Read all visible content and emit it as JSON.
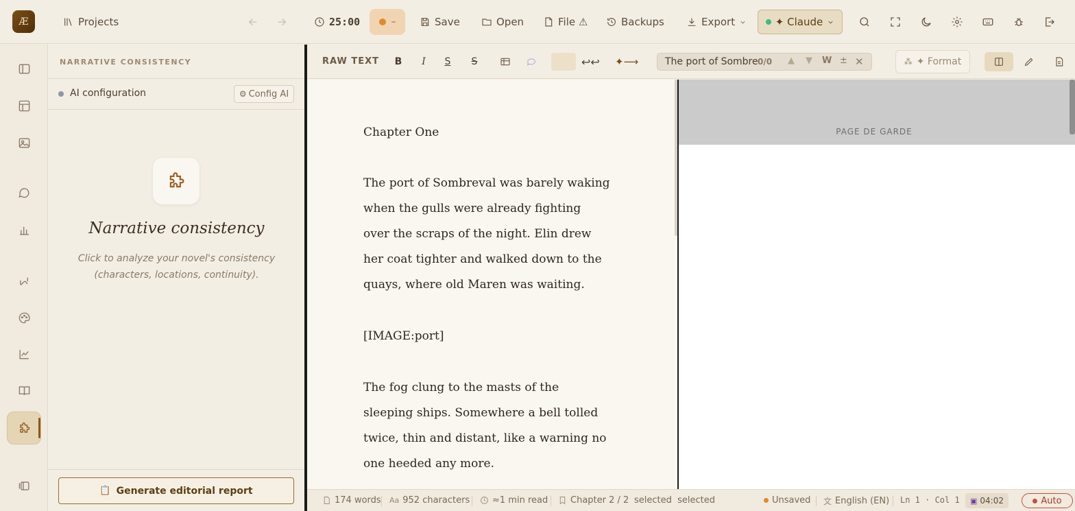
{
  "app": {
    "logo": "Æ"
  },
  "topbar": {
    "projects": "Projects",
    "timer": "25:00",
    "pomodoro_state": "–",
    "save": "Save",
    "open": "Open",
    "file": "File ⚠",
    "backups": "Backups",
    "export": "Export",
    "ai_model": "✦ Claude",
    "ai_status_color": "#3dbd7d"
  },
  "sidebar": {
    "title": "NARRATIVE CONSISTENCY",
    "ai_config_label": "AI configuration",
    "config_button": "Config AI",
    "heading": "Narrative consistency",
    "description": "Click to analyze your novel's consistency (characters, locations, continuity).",
    "report_button": "Generate editorial report"
  },
  "editor_toolbar": {
    "mode": "RAW TEXT",
    "bold": "B",
    "italic": "I",
    "underline": "S",
    "strike": "S",
    "search_value": "The port of Sombre",
    "search_count": "0/0",
    "search_word": "W",
    "search_case": "±",
    "format_button": "✦ Format"
  },
  "editor": {
    "paragraphs": [
      "Chapter One",
      "The port of Sombreval was barely waking when the gulls were already fighting over the scraps of the night. Elin drew her coat tighter and walked down to the quays, where old Maren was waiting.",
      "[IMAGE:port]",
      "The fog clung to the masts of the sleeping ships. Somewhere a bell tolled twice, thin and distant, like a warning no one heeded any more."
    ]
  },
  "preview": {
    "header": "PAGE DE GARDE"
  },
  "status": {
    "words": "174 words",
    "characters": "952 characters",
    "read_time": "≈1 min read",
    "chapter": "Chapter 2 / 2",
    "selection": "selected  selected",
    "save_state": "Unsaved",
    "language": "English (EN)",
    "cursor": "Ln 1 · Col 1",
    "save_time": "04:02",
    "autosave": "Auto"
  }
}
